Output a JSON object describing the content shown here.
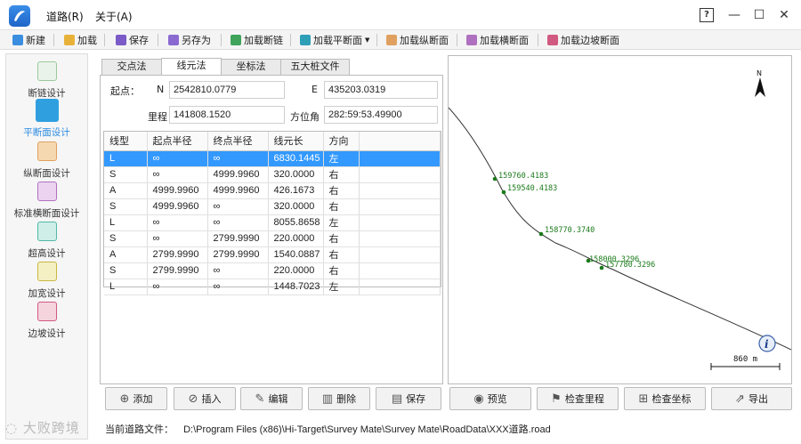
{
  "menu": {
    "road": "道路(R)",
    "about": "关于(A)"
  },
  "window": {
    "help": "?",
    "minimize": "—",
    "maximize": "☐",
    "close": "✕"
  },
  "toolbar": {
    "new": "新建",
    "load": "加载",
    "save": "保存",
    "save_as": "另存为",
    "load_chain": "加载断链",
    "load_plan": "加载平断面",
    "load_profile": "加载纵断面",
    "load_cross": "加载横断面",
    "load_slope": "加载边坡断面"
  },
  "nav": [
    {
      "label": "断链设计",
      "icon": "chain-icon"
    },
    {
      "label": "平断面设计",
      "icon": "plan-icon"
    },
    {
      "label": "纵断面设计",
      "icon": "profile-icon"
    },
    {
      "label": "标准横断面设计",
      "icon": "cross-section-icon"
    },
    {
      "label": "超高设计",
      "icon": "superelevation-icon"
    },
    {
      "label": "加宽设计",
      "icon": "widening-icon"
    },
    {
      "label": "边坡设计",
      "icon": "slope-icon"
    }
  ],
  "tabs": [
    "交点法",
    "线元法",
    "坐标法",
    "五大桩文件"
  ],
  "start": {
    "label": "起点：",
    "n_label": "N",
    "n_value": "2542810.0779",
    "e_label": "E",
    "e_value": "435203.0319",
    "mileage_label": "里程",
    "mileage_value": "141808.1520",
    "azimuth_label": "方位角",
    "azimuth_value": "282:59:53.49900"
  },
  "grid": {
    "headers": [
      "线型",
      "起点半径",
      "终点半径",
      "线元长",
      "方向"
    ],
    "rows": [
      [
        "L",
        "∞",
        "∞",
        "6830.1445",
        "左"
      ],
      [
        "S",
        "∞",
        "4999.9960",
        "320.0000",
        "右"
      ],
      [
        "A",
        "4999.9960",
        "4999.9960",
        "426.1673",
        "右"
      ],
      [
        "S",
        "4999.9960",
        "∞",
        "320.0000",
        "右"
      ],
      [
        "L",
        "∞",
        "∞",
        "8055.8658",
        "左"
      ],
      [
        "S",
        "∞",
        "2799.9990",
        "220.0000",
        "右"
      ],
      [
        "A",
        "2799.9990",
        "2799.9990",
        "1540.0887",
        "右"
      ],
      [
        "S",
        "2799.9990",
        "∞",
        "220.0000",
        "右"
      ],
      [
        "L",
        "∞",
        "∞",
        "1448.7023",
        "左"
      ]
    ]
  },
  "buttons": {
    "add": "添加",
    "insert": "插入",
    "edit": "编辑",
    "delete": "删除",
    "save": "保存",
    "preview": "预览",
    "check_mileage": "检查里程",
    "check_coords": "检查坐标",
    "export": "导出"
  },
  "canvas": {
    "north": "N",
    "points": [
      "159760.4183",
      "159540.4183",
      "158770.3740",
      "158000.3296",
      "157780.3296"
    ],
    "scale": "860 m",
    "info": "i"
  },
  "status": {
    "label": "当前道路文件：",
    "path": "D:\\Program Files (x86)\\Hi-Target\\Survey Mate\\Survey Mate\\RoadData\\XXX道路.road"
  },
  "watermark": "大败跨境"
}
